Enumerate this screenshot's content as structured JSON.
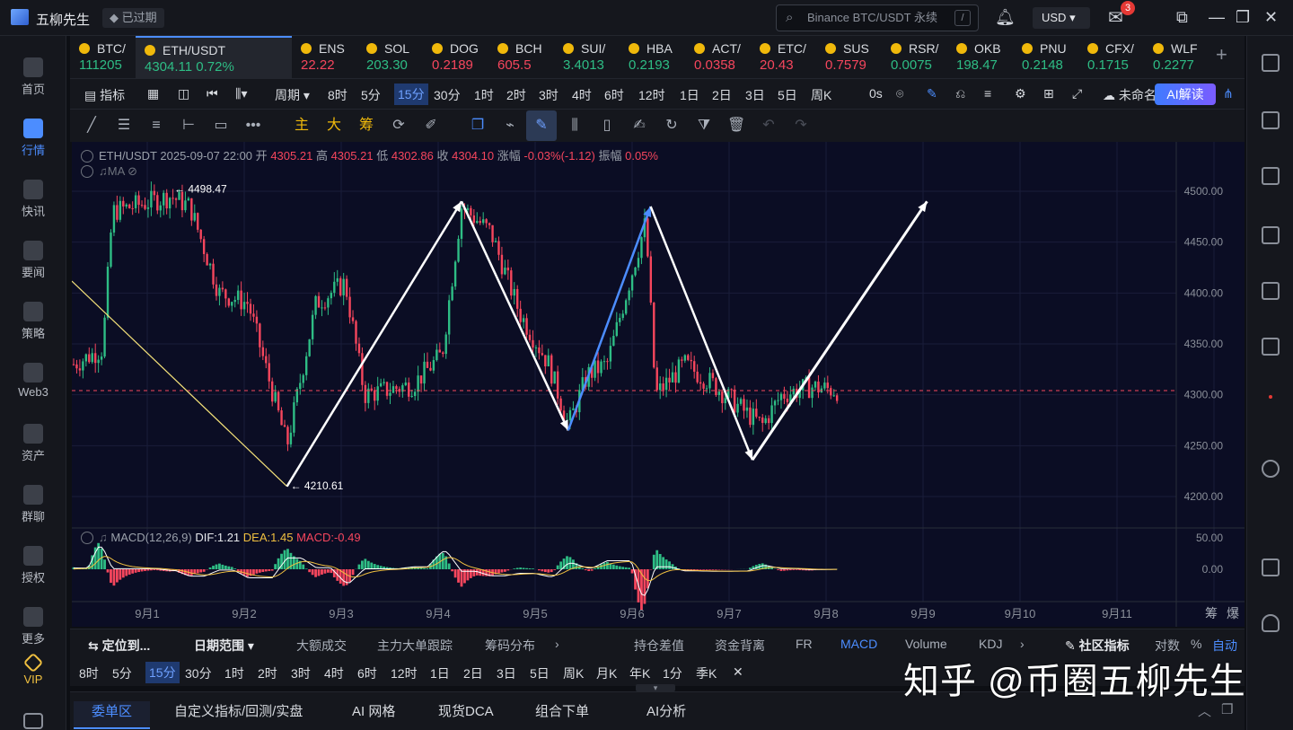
{
  "app": {
    "title": "五柳先生",
    "expired": "已过期"
  },
  "search": {
    "placeholder": "Binance BTC/USDT 永续",
    "shortcut": "/"
  },
  "header": {
    "currency": "USD",
    "mail_count": "3"
  },
  "sidebar": [
    {
      "label": "首页",
      "active": false
    },
    {
      "label": "行情",
      "active": true
    },
    {
      "label": "快讯",
      "active": false
    },
    {
      "label": "要闻",
      "active": false
    },
    {
      "label": "策略",
      "active": false
    },
    {
      "label": "Web3",
      "active": false
    },
    {
      "label": "资产",
      "active": false
    },
    {
      "label": "群聊",
      "active": false
    },
    {
      "label": "授权",
      "active": false
    },
    {
      "label": "更多",
      "active": false
    },
    {
      "label": "VIP",
      "active": false
    }
  ],
  "tickers": [
    {
      "symbol": "BTC/",
      "price": "111205",
      "dir": "up"
    },
    {
      "symbol": "ETH/USDT",
      "price": "4304.11",
      "change": "0.72%",
      "dir": "up",
      "active": true
    },
    {
      "symbol": "ENS",
      "price": "22.22",
      "dir": "dn"
    },
    {
      "symbol": "SOL",
      "price": "203.30",
      "dir": "up"
    },
    {
      "symbol": "DOG",
      "price": "0.2189",
      "dir": "dn"
    },
    {
      "symbol": "BCH",
      "price": "605.5",
      "dir": "dn"
    },
    {
      "symbol": "SUI/",
      "price": "3.4013",
      "dir": "up"
    },
    {
      "symbol": "HBA",
      "price": "0.2193",
      "dir": "up"
    },
    {
      "symbol": "ACT/",
      "price": "0.0358",
      "dir": "dn"
    },
    {
      "symbol": "ETC/",
      "price": "20.43",
      "dir": "dn"
    },
    {
      "symbol": "SUS",
      "price": "0.7579",
      "dir": "dn"
    },
    {
      "symbol": "RSR/",
      "price": "0.0075",
      "dir": "up"
    },
    {
      "symbol": "OKB",
      "price": "198.47",
      "dir": "up"
    },
    {
      "symbol": "PNU",
      "price": "0.2148",
      "dir": "up"
    },
    {
      "symbol": "CFX/",
      "price": "0.1715",
      "dir": "up"
    },
    {
      "symbol": "WLF",
      "price": "0.2277",
      "dir": "up"
    }
  ],
  "toolbar": {
    "indicator": "指标",
    "period": "周期",
    "intervals": [
      "8时",
      "5分",
      "15分",
      "30分",
      "1时",
      "2时",
      "3时",
      "4时",
      "6时",
      "12时",
      "1日",
      "2日",
      "3日",
      "5日",
      "周K"
    ],
    "active_interval": "15分",
    "countdown": "0s",
    "layout_name": "未命名",
    "ai_label": "AI解读"
  },
  "drawtools": {
    "main": "主",
    "big": "大",
    "chips": "筹"
  },
  "legend": {
    "pair": "ETH/USDT",
    "datetime": "2025-09-07 22:00",
    "open_label": "开",
    "open": "4305.21",
    "high_label": "高",
    "high": "4305.21",
    "low_label": "低",
    "low": "4302.86",
    "close_label": "收",
    "close": "4304.10",
    "chg_label": "涨幅",
    "chg": "-0.03%(-1.12)",
    "amp_label": "振幅",
    "amp": "0.05%",
    "ma": "MA"
  },
  "macd_legend": {
    "name": "MACD(12,26,9)",
    "dif": "DIF:1.21",
    "dea": "DEA:1.45",
    "macd": "MACD:-0.49"
  },
  "chart_data": {
    "type": "candlestick",
    "y_axis": {
      "min": 4200,
      "max": 4500,
      "ticks": [
        "4500.00",
        "4450.00",
        "4400.00",
        "4350.00",
        "4300.00",
        "4250.00",
        "4200.00"
      ]
    },
    "macd_axis": {
      "ticks": [
        "50.00",
        "0.00"
      ]
    },
    "x_ticks": [
      "9月1",
      "9月2",
      "9月3",
      "9月4",
      "9月5",
      "9月6",
      "9月7",
      "9月8",
      "9月9",
      "9月10",
      "9月11"
    ],
    "high_label": "4498.47",
    "low_label": "4210.61",
    "last_price": 4304.1,
    "price_path": [
      [
        0,
        4330
      ],
      [
        0.3,
        4345
      ],
      [
        0.4,
        4480
      ],
      [
        1.0,
        4495
      ],
      [
        1.2,
        4485
      ],
      [
        1.5,
        4400
      ],
      [
        1.8,
        4390
      ],
      [
        2.0,
        4320
      ],
      [
        2.2,
        4250
      ],
      [
        2.5,
        4390
      ],
      [
        2.8,
        4410
      ],
      [
        3.0,
        4300
      ],
      [
        3.5,
        4310
      ],
      [
        3.8,
        4340
      ],
      [
        4.0,
        4485
      ],
      [
        4.3,
        4460
      ],
      [
        4.6,
        4380
      ],
      [
        4.9,
        4330
      ],
      [
        5.1,
        4270
      ],
      [
        5.3,
        4320
      ],
      [
        5.5,
        4330
      ],
      [
        5.7,
        4400
      ],
      [
        5.9,
        4470
      ],
      [
        6.0,
        4300
      ],
      [
        6.3,
        4330
      ],
      [
        6.6,
        4310
      ],
      [
        6.9,
        4285
      ],
      [
        7.1,
        4270
      ],
      [
        7.3,
        4300
      ],
      [
        7.6,
        4308
      ],
      [
        7.9,
        4304
      ]
    ],
    "drawn_arrows": [
      {
        "from": [
          "9月2",
          4210
        ],
        "to": [
          "9月4",
          4490
        ],
        "color": "white"
      },
      {
        "from": [
          "9月4",
          4490
        ],
        "to": [
          "9月5",
          4270
        ],
        "color": "white"
      },
      {
        "from": [
          "9月5",
          4270
        ],
        "to": [
          "9月6",
          4485
        ],
        "color": "blue"
      },
      {
        "from": [
          "9月6",
          4485
        ],
        "to": [
          "9月7",
          4235
        ],
        "color": "white"
      },
      {
        "from": [
          "9月7",
          4235
        ],
        "to": [
          "9月9",
          4490
        ],
        "color": "white"
      }
    ],
    "trend_line": {
      "from": [
        "8月31",
        4410
      ],
      "to": [
        "9月2",
        4210
      ],
      "color": "#f5e27a"
    }
  },
  "indicator_bar": {
    "locate": "定位到...",
    "date_range": "日期范围",
    "items": [
      "大额成交",
      "主力大单跟踪",
      "筹码分布"
    ],
    "right_items": [
      "持仓差值",
      "资金背离",
      "FR",
      "MACD",
      "Volume",
      "KDJ"
    ],
    "active": "MACD",
    "community": "社区指标",
    "log": "对数",
    "pct": "%",
    "auto": "自动"
  },
  "period_bar": {
    "items": [
      "8时",
      "5分",
      "15分",
      "30分",
      "1时",
      "2时",
      "3时",
      "4时",
      "6时",
      "12时",
      "1日",
      "2日",
      "3日",
      "5日",
      "周K",
      "月K",
      "年K",
      "1分",
      "季K"
    ],
    "active": "15分"
  },
  "bottom_tabs": [
    "委单区",
    "自定义指标/回测/实盘",
    "AI 网格",
    "现货DCA",
    "组合下单",
    "AI分析"
  ],
  "chart_corner": {
    "chips": "筹",
    "burst": "爆"
  },
  "watermark": "知乎 @币圈五柳先生"
}
